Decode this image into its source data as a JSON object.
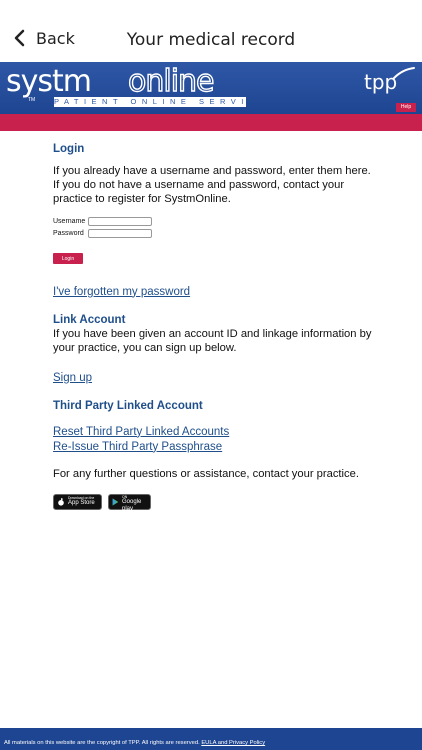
{
  "navbar": {
    "back_label": "Back",
    "title": "Your medical record"
  },
  "banner": {
    "logo_systm": "systm",
    "logo_online": "online",
    "logo_tm": "TM",
    "logo_subtitle": "PATIENT ONLINE SERVICE",
    "tpp_logo": "tpp",
    "help_label": "Help"
  },
  "login": {
    "heading": "Login",
    "intro_1": "If you already have a username and password, enter them here.",
    "intro_2": "If you do not have a username and password, contact your practice to register for SystmOnline.",
    "username_label": "Username",
    "username_value": "",
    "password_label": "Password",
    "password_value": "",
    "login_button": "Login",
    "forgot_link": "I've forgotten my password"
  },
  "link_account": {
    "heading": "Link Account",
    "text": "If you have been given an account ID and linkage information by your practice, you can sign up below.",
    "signup_link": "Sign up"
  },
  "third_party": {
    "heading": "Third Party Linked Account",
    "reset_link": "Reset Third Party Linked Accounts",
    "reissue_link": "Re-Issue Third Party Passphrase"
  },
  "assistance": "For any further questions or assistance, contact your practice.",
  "stores": {
    "app_store_small": "Download on the",
    "app_store": "App Store",
    "google_play_small": "ANDROID APP ON",
    "google_play": "Google play"
  },
  "footer": {
    "copyright": "All materials on this website are the copyright of TPP. All rights are reserved.",
    "eula_link": "EULA and Privacy Policy"
  },
  "colors": {
    "brand_blue": "#1e4591",
    "magenta": "#c8214e",
    "link_blue": "#1f4f8b"
  }
}
